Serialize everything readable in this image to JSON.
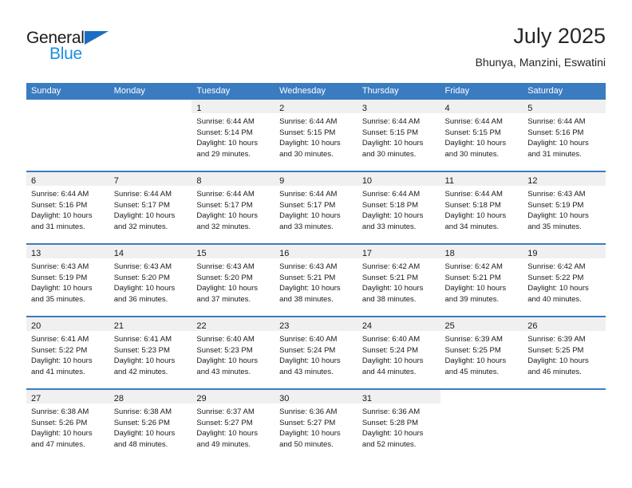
{
  "brand": {
    "logo_text_primary": "General",
    "logo_text_secondary": "Blue",
    "logo_icon": "triangle-flag-icon",
    "color_dark": "#1a1a1a",
    "color_blue": "#1a8fe0",
    "color_triangle": "#1a6fc4"
  },
  "header": {
    "title": "July 2025",
    "subtitle": "Bhunya, Manzini, Eswatini"
  },
  "theme": {
    "header_blue": "#3b7cc0",
    "daynum_band": "#f0f0f0",
    "text": "#1a1a1a"
  },
  "weekdays": [
    {
      "label": "Sunday"
    },
    {
      "label": "Monday"
    },
    {
      "label": "Tuesday"
    },
    {
      "label": "Wednesday"
    },
    {
      "label": "Thursday"
    },
    {
      "label": "Friday"
    },
    {
      "label": "Saturday"
    }
  ],
  "weeks": [
    {
      "days": [
        {
          "empty": true
        },
        {
          "empty": true
        },
        {
          "day": "1",
          "sunrise": "Sunrise: 6:44 AM",
          "sunset": "Sunset: 5:14 PM",
          "daylight_1": "Daylight: 10 hours",
          "daylight_2": "and 29 minutes."
        },
        {
          "day": "2",
          "sunrise": "Sunrise: 6:44 AM",
          "sunset": "Sunset: 5:15 PM",
          "daylight_1": "Daylight: 10 hours",
          "daylight_2": "and 30 minutes."
        },
        {
          "day": "3",
          "sunrise": "Sunrise: 6:44 AM",
          "sunset": "Sunset: 5:15 PM",
          "daylight_1": "Daylight: 10 hours",
          "daylight_2": "and 30 minutes."
        },
        {
          "day": "4",
          "sunrise": "Sunrise: 6:44 AM",
          "sunset": "Sunset: 5:15 PM",
          "daylight_1": "Daylight: 10 hours",
          "daylight_2": "and 30 minutes."
        },
        {
          "day": "5",
          "sunrise": "Sunrise: 6:44 AM",
          "sunset": "Sunset: 5:16 PM",
          "daylight_1": "Daylight: 10 hours",
          "daylight_2": "and 31 minutes."
        }
      ]
    },
    {
      "days": [
        {
          "day": "6",
          "sunrise": "Sunrise: 6:44 AM",
          "sunset": "Sunset: 5:16 PM",
          "daylight_1": "Daylight: 10 hours",
          "daylight_2": "and 31 minutes."
        },
        {
          "day": "7",
          "sunrise": "Sunrise: 6:44 AM",
          "sunset": "Sunset: 5:17 PM",
          "daylight_1": "Daylight: 10 hours",
          "daylight_2": "and 32 minutes."
        },
        {
          "day": "8",
          "sunrise": "Sunrise: 6:44 AM",
          "sunset": "Sunset: 5:17 PM",
          "daylight_1": "Daylight: 10 hours",
          "daylight_2": "and 32 minutes."
        },
        {
          "day": "9",
          "sunrise": "Sunrise: 6:44 AM",
          "sunset": "Sunset: 5:17 PM",
          "daylight_1": "Daylight: 10 hours",
          "daylight_2": "and 33 minutes."
        },
        {
          "day": "10",
          "sunrise": "Sunrise: 6:44 AM",
          "sunset": "Sunset: 5:18 PM",
          "daylight_1": "Daylight: 10 hours",
          "daylight_2": "and 33 minutes."
        },
        {
          "day": "11",
          "sunrise": "Sunrise: 6:44 AM",
          "sunset": "Sunset: 5:18 PM",
          "daylight_1": "Daylight: 10 hours",
          "daylight_2": "and 34 minutes."
        },
        {
          "day": "12",
          "sunrise": "Sunrise: 6:43 AM",
          "sunset": "Sunset: 5:19 PM",
          "daylight_1": "Daylight: 10 hours",
          "daylight_2": "and 35 minutes."
        }
      ]
    },
    {
      "days": [
        {
          "day": "13",
          "sunrise": "Sunrise: 6:43 AM",
          "sunset": "Sunset: 5:19 PM",
          "daylight_1": "Daylight: 10 hours",
          "daylight_2": "and 35 minutes."
        },
        {
          "day": "14",
          "sunrise": "Sunrise: 6:43 AM",
          "sunset": "Sunset: 5:20 PM",
          "daylight_1": "Daylight: 10 hours",
          "daylight_2": "and 36 minutes."
        },
        {
          "day": "15",
          "sunrise": "Sunrise: 6:43 AM",
          "sunset": "Sunset: 5:20 PM",
          "daylight_1": "Daylight: 10 hours",
          "daylight_2": "and 37 minutes."
        },
        {
          "day": "16",
          "sunrise": "Sunrise: 6:43 AM",
          "sunset": "Sunset: 5:21 PM",
          "daylight_1": "Daylight: 10 hours",
          "daylight_2": "and 38 minutes."
        },
        {
          "day": "17",
          "sunrise": "Sunrise: 6:42 AM",
          "sunset": "Sunset: 5:21 PM",
          "daylight_1": "Daylight: 10 hours",
          "daylight_2": "and 38 minutes."
        },
        {
          "day": "18",
          "sunrise": "Sunrise: 6:42 AM",
          "sunset": "Sunset: 5:21 PM",
          "daylight_1": "Daylight: 10 hours",
          "daylight_2": "and 39 minutes."
        },
        {
          "day": "19",
          "sunrise": "Sunrise: 6:42 AM",
          "sunset": "Sunset: 5:22 PM",
          "daylight_1": "Daylight: 10 hours",
          "daylight_2": "and 40 minutes."
        }
      ]
    },
    {
      "days": [
        {
          "day": "20",
          "sunrise": "Sunrise: 6:41 AM",
          "sunset": "Sunset: 5:22 PM",
          "daylight_1": "Daylight: 10 hours",
          "daylight_2": "and 41 minutes."
        },
        {
          "day": "21",
          "sunrise": "Sunrise: 6:41 AM",
          "sunset": "Sunset: 5:23 PM",
          "daylight_1": "Daylight: 10 hours",
          "daylight_2": "and 42 minutes."
        },
        {
          "day": "22",
          "sunrise": "Sunrise: 6:40 AM",
          "sunset": "Sunset: 5:23 PM",
          "daylight_1": "Daylight: 10 hours",
          "daylight_2": "and 43 minutes."
        },
        {
          "day": "23",
          "sunrise": "Sunrise: 6:40 AM",
          "sunset": "Sunset: 5:24 PM",
          "daylight_1": "Daylight: 10 hours",
          "daylight_2": "and 43 minutes."
        },
        {
          "day": "24",
          "sunrise": "Sunrise: 6:40 AM",
          "sunset": "Sunset: 5:24 PM",
          "daylight_1": "Daylight: 10 hours",
          "daylight_2": "and 44 minutes."
        },
        {
          "day": "25",
          "sunrise": "Sunrise: 6:39 AM",
          "sunset": "Sunset: 5:25 PM",
          "daylight_1": "Daylight: 10 hours",
          "daylight_2": "and 45 minutes."
        },
        {
          "day": "26",
          "sunrise": "Sunrise: 6:39 AM",
          "sunset": "Sunset: 5:25 PM",
          "daylight_1": "Daylight: 10 hours",
          "daylight_2": "and 46 minutes."
        }
      ]
    },
    {
      "days": [
        {
          "day": "27",
          "sunrise": "Sunrise: 6:38 AM",
          "sunset": "Sunset: 5:26 PM",
          "daylight_1": "Daylight: 10 hours",
          "daylight_2": "and 47 minutes."
        },
        {
          "day": "28",
          "sunrise": "Sunrise: 6:38 AM",
          "sunset": "Sunset: 5:26 PM",
          "daylight_1": "Daylight: 10 hours",
          "daylight_2": "and 48 minutes."
        },
        {
          "day": "29",
          "sunrise": "Sunrise: 6:37 AM",
          "sunset": "Sunset: 5:27 PM",
          "daylight_1": "Daylight: 10 hours",
          "daylight_2": "and 49 minutes."
        },
        {
          "day": "30",
          "sunrise": "Sunrise: 6:36 AM",
          "sunset": "Sunset: 5:27 PM",
          "daylight_1": "Daylight: 10 hours",
          "daylight_2": "and 50 minutes."
        },
        {
          "day": "31",
          "sunrise": "Sunrise: 6:36 AM",
          "sunset": "Sunset: 5:28 PM",
          "daylight_1": "Daylight: 10 hours",
          "daylight_2": "and 52 minutes."
        },
        {
          "empty": true
        },
        {
          "empty": true
        }
      ]
    }
  ]
}
